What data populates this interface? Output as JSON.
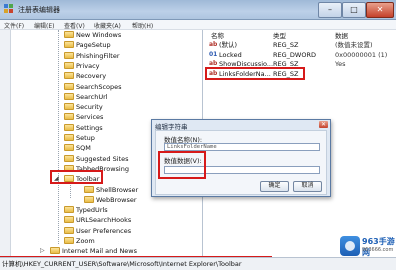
{
  "window": {
    "title": "注册表编辑器",
    "controls": {
      "minimize": "–",
      "maximize": "□",
      "close": "✕"
    }
  },
  "menubar": {
    "items": [
      "文件(F)",
      "编辑(E)",
      "查看(V)",
      "收藏夹(A)",
      "帮助(H)"
    ]
  },
  "tree": {
    "items": [
      {
        "label": "New Windows",
        "level": 0,
        "expander": ""
      },
      {
        "label": "PageSetup",
        "level": 0,
        "expander": ""
      },
      {
        "label": "PhishingFilter",
        "level": 0,
        "expander": ""
      },
      {
        "label": "Privacy",
        "level": 0,
        "expander": ""
      },
      {
        "label": "Recovery",
        "level": 0,
        "expander": ""
      },
      {
        "label": "SearchScopes",
        "level": 0,
        "expander": ""
      },
      {
        "label": "SearchUrl",
        "level": 0,
        "expander": ""
      },
      {
        "label": "Security",
        "level": 0,
        "expander": ""
      },
      {
        "label": "Services",
        "level": 0,
        "expander": ""
      },
      {
        "label": "Settings",
        "level": 0,
        "expander": ""
      },
      {
        "label": "Setup",
        "level": 0,
        "expander": ""
      },
      {
        "label": "SQM",
        "level": 0,
        "expander": ""
      },
      {
        "label": "Suggested Sites",
        "level": 0,
        "expander": ""
      },
      {
        "label": "TabbedBrowsing",
        "level": 0,
        "expander": ""
      },
      {
        "label": "Toolbar",
        "level": 0,
        "expander": "◢",
        "open": true
      },
      {
        "label": "ShellBrowser",
        "level": 1,
        "expander": ""
      },
      {
        "label": "WebBrowser",
        "level": 1,
        "expander": ""
      },
      {
        "label": "TypedUrls",
        "level": 0,
        "expander": ""
      },
      {
        "label": "URLSearchHooks",
        "level": 0,
        "expander": ""
      },
      {
        "label": "User Preferences",
        "level": 0,
        "expander": ""
      },
      {
        "label": "Zoom",
        "level": 0,
        "expander": ""
      },
      {
        "label": "Internet Mail and News",
        "level": -1,
        "expander": "▷"
      }
    ]
  },
  "values": {
    "headers": {
      "name": "名称",
      "type": "类型",
      "data": "数据"
    },
    "rows": [
      {
        "icon": "ab",
        "name": "(默认)",
        "type": "REG_SZ",
        "data": "(数值未设置)"
      },
      {
        "icon": "01",
        "name": "Locked",
        "type": "REG_DWORD",
        "data": "0x00000001 (1)"
      },
      {
        "icon": "ab",
        "name": "ShowDiscussio...",
        "type": "REG_SZ",
        "data": "Yes"
      },
      {
        "icon": "ab",
        "name": "LinksFolderNa...",
        "type": "REG_SZ",
        "data": ""
      }
    ]
  },
  "dialog": {
    "title": "编辑字符串",
    "close": "✕",
    "name_label": "数值名称(N):",
    "name_value": "LinksFolderName",
    "data_label": "数值数据(V):",
    "data_value": "",
    "ok": "确定",
    "cancel": "取消"
  },
  "status": {
    "path": "计算机\\HKEY_CURRENT_USER\\Software\\Microsoft\\Internet Explorer\\Toolbar"
  },
  "watermark": {
    "brand": "963手游网",
    "sub": "963666.com"
  },
  "colors": {
    "highlight_box": "#d61a1a",
    "dialog_frame": "#5b7aa3"
  }
}
